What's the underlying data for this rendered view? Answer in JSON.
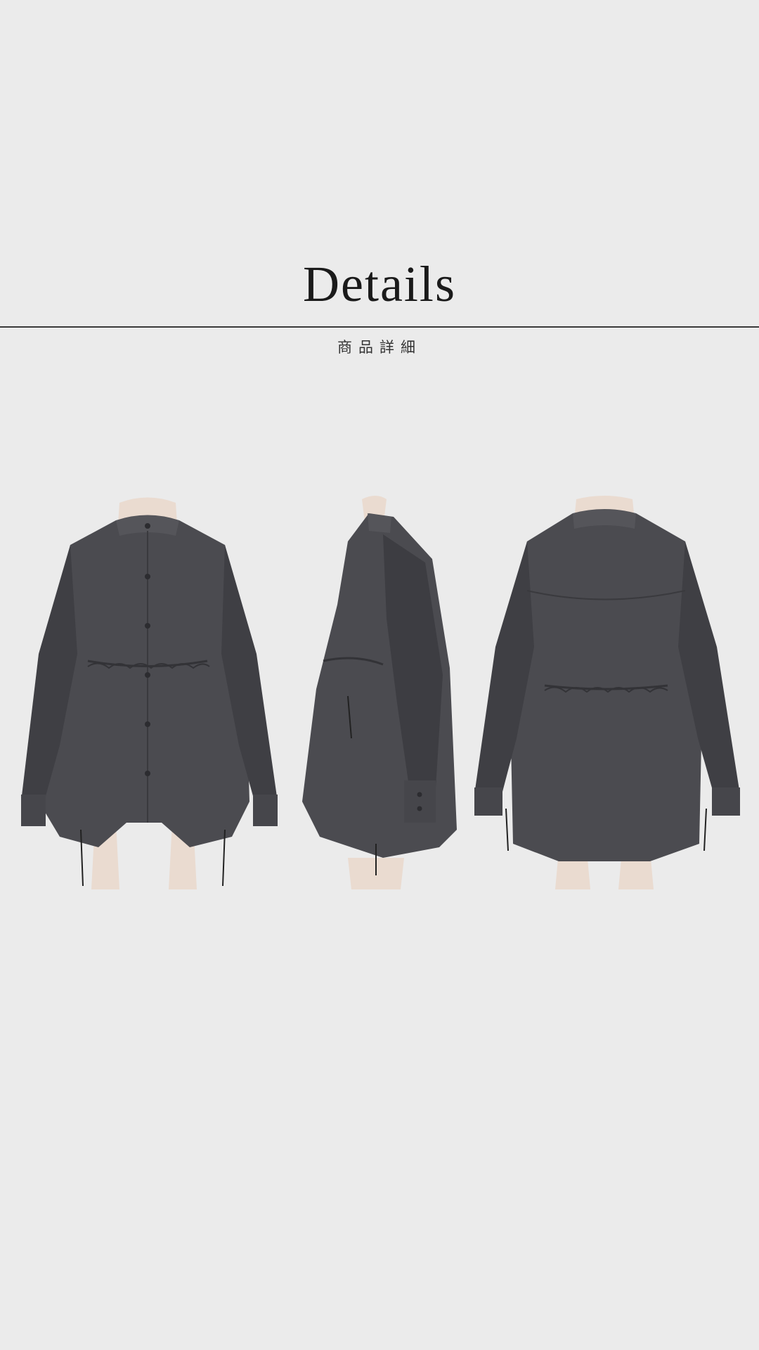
{
  "header": {
    "title": "Details",
    "subtitle": "商品詳細"
  },
  "photos": [
    {
      "view": "front"
    },
    {
      "view": "side"
    },
    {
      "view": "back"
    }
  ],
  "colors": {
    "background": "#ebebeb",
    "garment": "#4b4b50",
    "mannequin": "#eadbd0"
  }
}
